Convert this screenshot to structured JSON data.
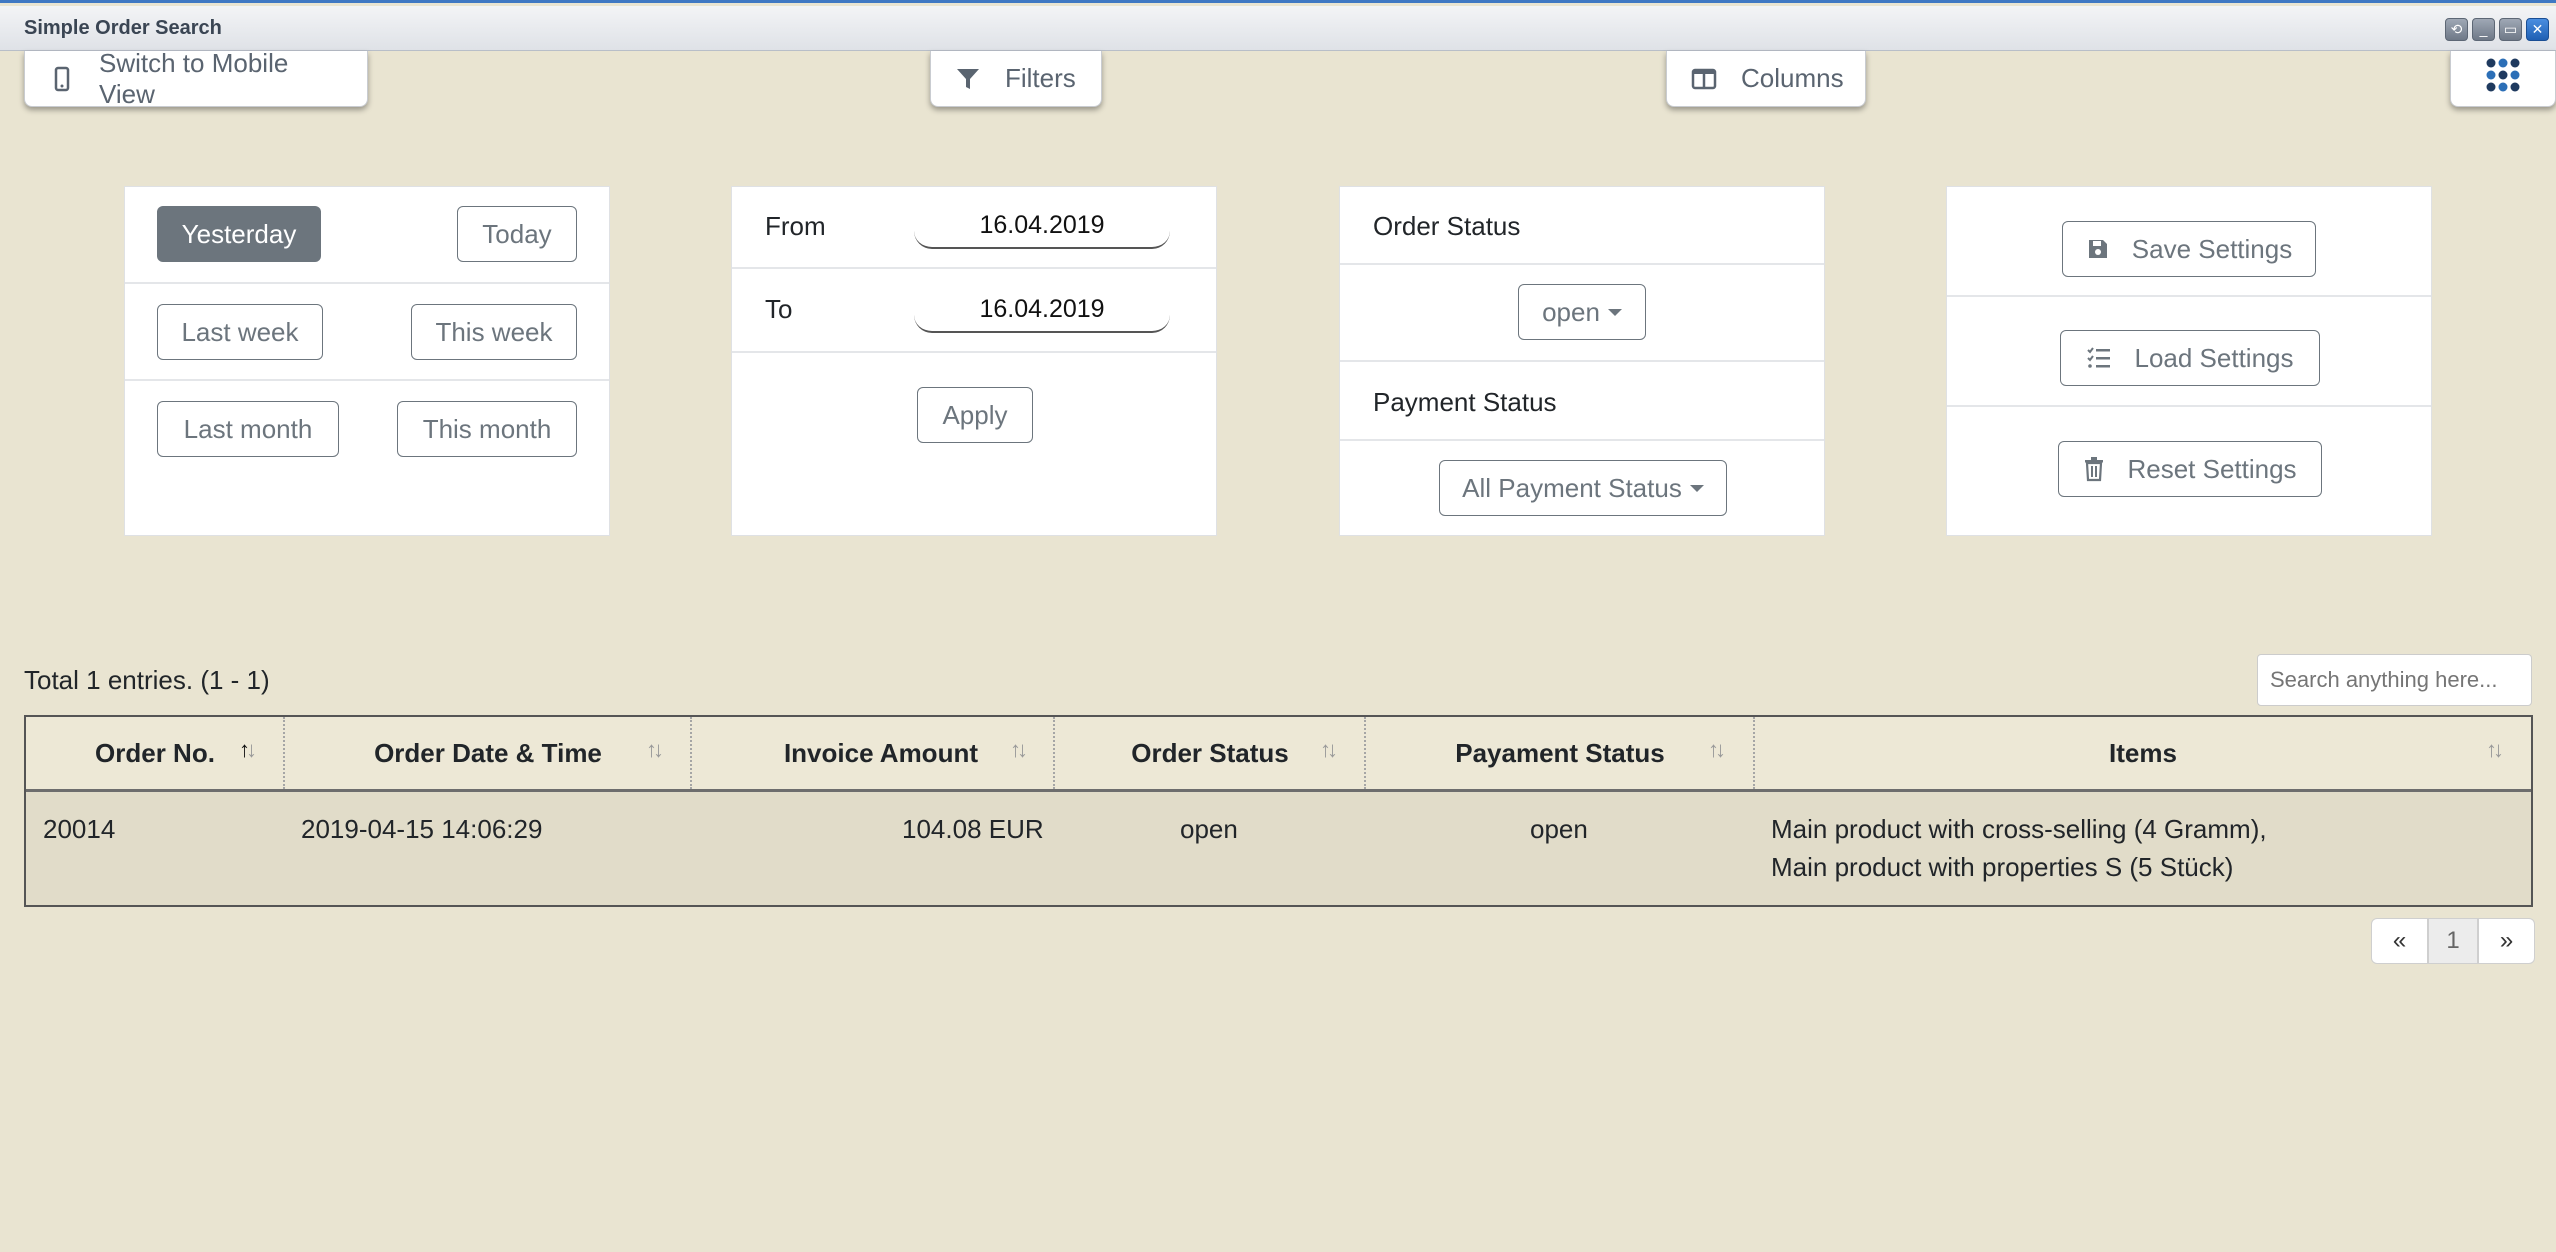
{
  "window": {
    "title": "Simple Order Search"
  },
  "toolbar": {
    "mobile_view": "Switch to Mobile View",
    "filters": "Filters",
    "columns": "Columns"
  },
  "date_presets": {
    "yesterday": "Yesterday",
    "today": "Today",
    "last_week": "Last week",
    "this_week": "This week",
    "last_month": "Last month",
    "this_month": "This month"
  },
  "date_range": {
    "from_label": "From",
    "from_value": "16.04.2019",
    "to_label": "To",
    "to_value": "16.04.2019",
    "apply": "Apply"
  },
  "status_filters": {
    "order_status_label": "Order Status",
    "order_status_value": "open",
    "payment_status_label": "Payment Status",
    "payment_status_value": "All Payment Status"
  },
  "settings": {
    "save": "Save Settings",
    "load": "Load Settings",
    "reset": "Reset Settings"
  },
  "table": {
    "summary": "Total 1 entries. (1 - 1)",
    "search_placeholder": "Search anything here...",
    "columns": [
      "Order No.",
      "Order Date & Time",
      "Invoice Amount",
      "Order Status",
      "Payament Status",
      "Items"
    ],
    "rows": [
      {
        "order_no": "20014",
        "date_time": "2019-04-15 14:06:29",
        "invoice_amount": "104.08 EUR",
        "order_status": "open",
        "payment_status": "open",
        "items_line1": "Main product with cross-selling (4 Gramm),",
        "items_line2": "Main product with properties S (5 Stück)"
      }
    ]
  },
  "pagination": {
    "prev": "«",
    "current": "1",
    "next": "»"
  },
  "icons": [
    "mobile-icon",
    "filter-icon",
    "columns-icon",
    "app-grid-icon",
    "save-icon",
    "list-check-icon",
    "trash-icon",
    "sort-icon"
  ],
  "colors": {
    "background": "#e9e4d1",
    "active_preset": "#6c757d",
    "title_accent": "#3f78c3"
  }
}
